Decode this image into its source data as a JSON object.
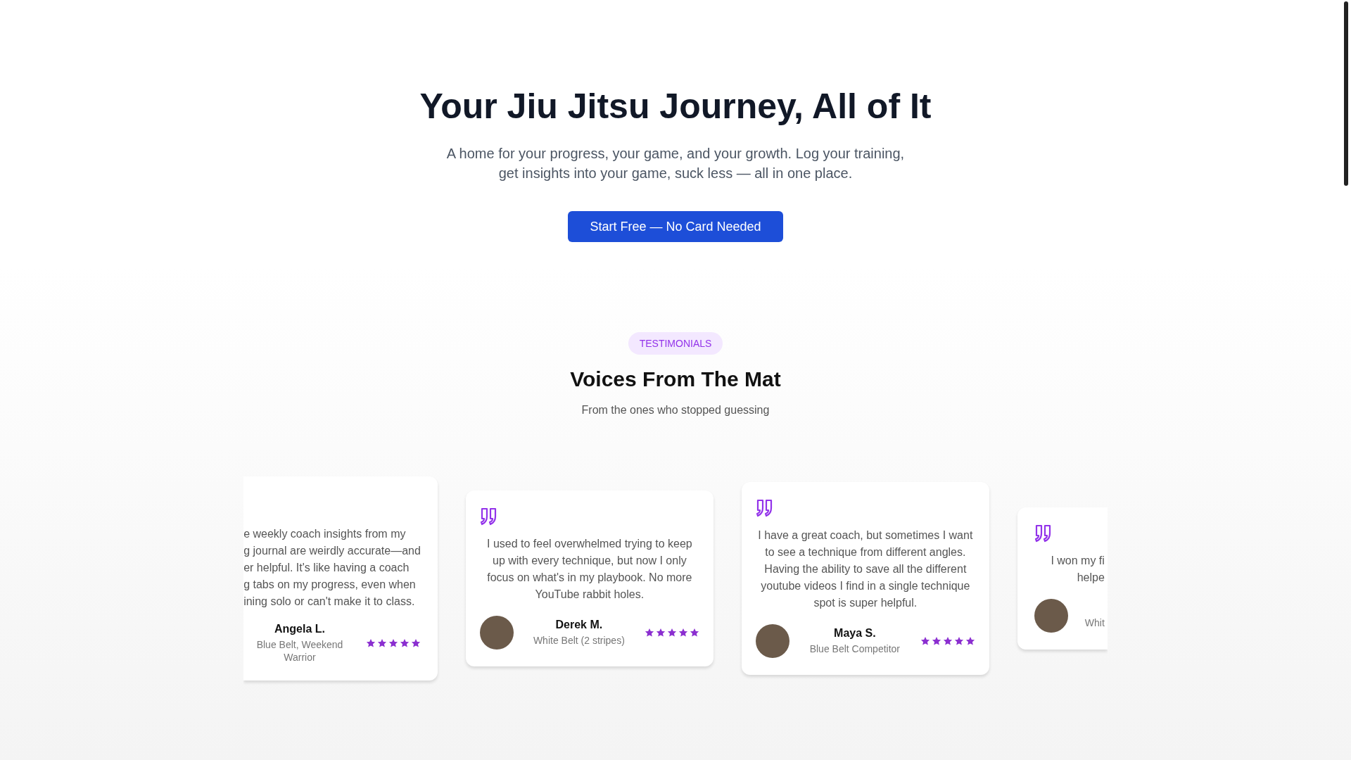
{
  "hero": {
    "title": "Your Jiu Jitsu Journey, All of It",
    "subtitle": "A home for your progress, your game, and your growth. Log your training, get insights into your game, suck less — all in one place.",
    "cta": "Start Free — No Card Needed"
  },
  "testimonials": {
    "badge": "TESTIMONIALS",
    "title": "Voices From The Mat",
    "subtitle": "From the ones who stopped guessing",
    "cards": [
      {
        "kind": "leftcut",
        "quote_lines": [
          "e weekly coach insights from my",
          "g journal are weirdly accurate—and",
          "er helpful. It's like having a coach",
          "g tabs on my progress, even when",
          "ining solo or can't make it to class."
        ],
        "name": "Angela L.",
        "role": "Blue Belt, Weekend Warrior",
        "stars": 5
      },
      {
        "kind": "full",
        "quote_lines": [
          "I used to feel overwhelmed trying to keep up with every technique, but now I only focus on what's in my playbook. No more YouTube rabbit holes."
        ],
        "name": "Derek M.",
        "role": "White Belt (2 stripes)",
        "stars": 5
      },
      {
        "kind": "full",
        "quote_lines": [
          "I have a great coach, but sometimes I want to see a technique from different angles. Having the ability to save all the different youtube videos I find in a single technique spot is super helpful."
        ],
        "name": "Maya S.",
        "role": "Blue Belt Competitor",
        "stars": 5
      },
      {
        "kind": "rightcut",
        "quote_lines": [
          "I won my fi",
          "helpe"
        ],
        "role": "Whit"
      }
    ]
  }
}
